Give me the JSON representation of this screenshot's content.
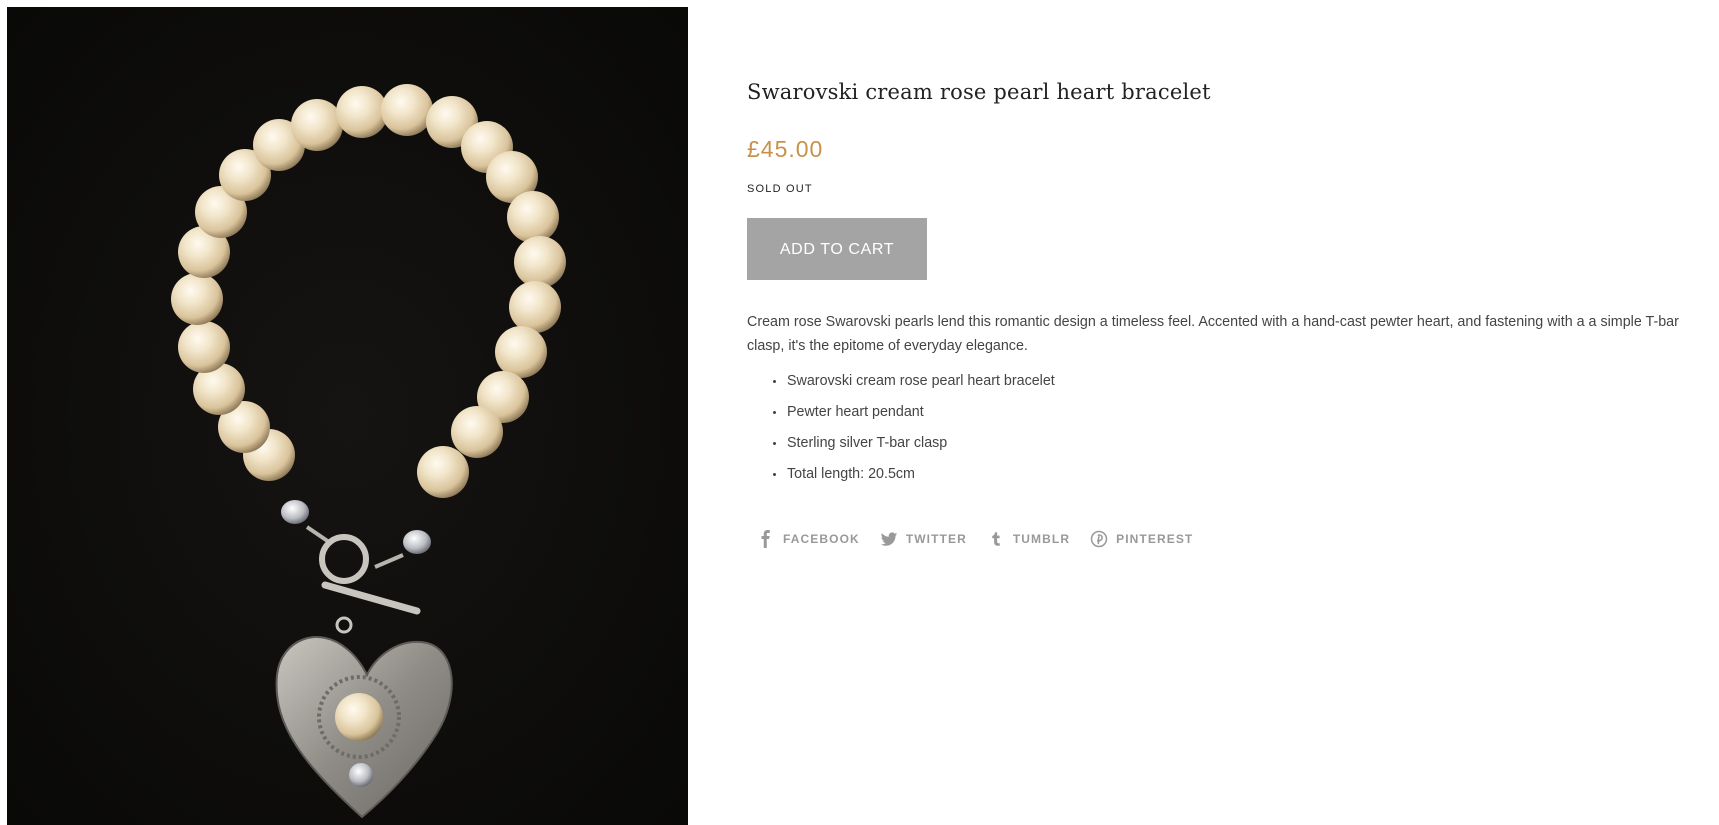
{
  "product": {
    "title": "Swarovski cream rose pearl heart bracelet",
    "price": "£45.00",
    "availability": "SOLD OUT",
    "add_to_cart_label": "ADD TO CART",
    "description": "Cream rose Swarovski pearls lend this romantic design a timeless feel. Accented with a hand-cast pewter heart, and fastening with a a simple T-bar clasp, it's the epitome of everyday elegance.",
    "features": [
      "Swarovski cream rose pearl heart bracelet",
      "Pewter heart pendant",
      "Sterling silver T-bar clasp",
      "Total length: 20.5cm"
    ],
    "image_icon": "pearl-bracelet-photo"
  },
  "share": {
    "facebook": "FACEBOOK",
    "twitter": "TWITTER",
    "tumblr": "TUMBLR",
    "pinterest": "PINTEREST"
  },
  "colors": {
    "price": "#c8914a",
    "button_disabled": "#a4a4a4",
    "share_text": "#999999",
    "image_background": "#0d0c0a"
  }
}
